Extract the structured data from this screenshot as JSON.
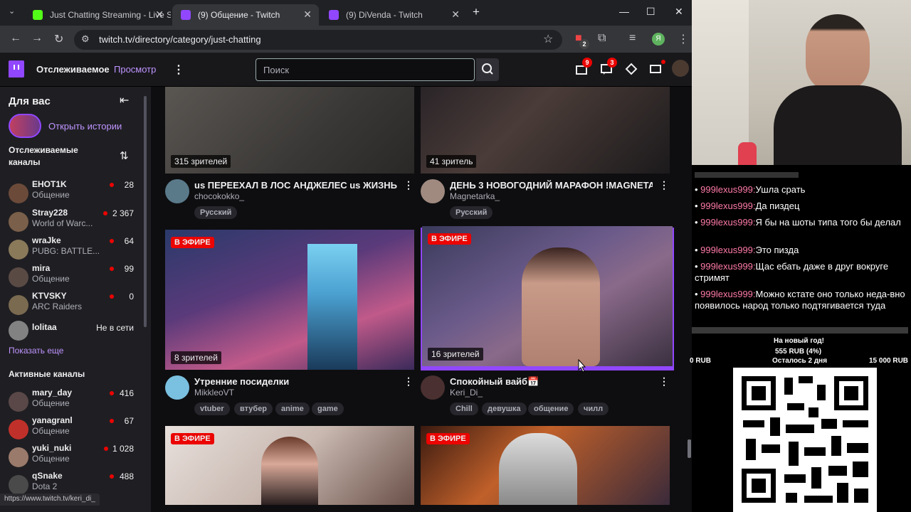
{
  "browser": {
    "tabs": [
      {
        "title": "Just Chatting Streaming - Live S"
      },
      {
        "title": "(9) Общение - Twitch"
      },
      {
        "title": "(9) DiVenda - Twitch"
      }
    ],
    "url": "twitch.tv/directory/category/just-chatting",
    "profile_letter": "Я",
    "ext_badge": "2",
    "status_url": "https://www.twitch.tv/keri_di_"
  },
  "twitch_nav": {
    "following": "Отслеживаемое",
    "browse": "Просмотр",
    "search_placeholder": "Поиск",
    "inbox_count": "9",
    "whispers_count": "3"
  },
  "sidebar": {
    "for_you": "Для вас",
    "open_stories": "Открыть истории",
    "followed_header": "Отслеживаемые каналы",
    "followed": [
      {
        "name": "EHOT1K",
        "game": "Общение",
        "viewers": "28",
        "color": "#6b4a3a"
      },
      {
        "name": "Stray228",
        "game": "World of Warc...",
        "viewers": "2 367",
        "color": "#7a5f4a"
      },
      {
        "name": "wraJke",
        "game": "PUBG: BATTLE...",
        "viewers": "64",
        "color": "#8a7a5a"
      },
      {
        "name": "mira",
        "game": "Общение",
        "viewers": "99",
        "color": "#5a4a44"
      },
      {
        "name": "KTVSKY",
        "game": "ARC Raiders",
        "viewers": "0",
        "color": "#7a6a50"
      },
      {
        "name": "lolitaa",
        "game": "",
        "viewers": "Не в сети",
        "color": "#8a8078"
      }
    ],
    "show_more": "Показать еще",
    "active_header": "Активные каналы",
    "active": [
      {
        "name": "mary_day",
        "game": "Общение",
        "viewers": "416",
        "color": "#5a4848"
      },
      {
        "name": "yanagranl",
        "game": "Общение",
        "viewers": "67",
        "color": "#c0302a"
      },
      {
        "name": "yuki_nuki",
        "game": "Общение",
        "viewers": "1 028",
        "color": "#9a7a6a"
      },
      {
        "name": "qSnake",
        "game": "Dota 2",
        "viewers": "488",
        "color": "#4a4a4a"
      }
    ]
  },
  "streams": [
    {
      "viewers": "315 зрителей",
      "title": "us ПЕРЕЕХАЛ В ЛОС АНДЖЕЛЕС us ЖИЗНЬ К...",
      "channel": "chocokokko_",
      "tags": [
        "Русский"
      ],
      "live": false
    },
    {
      "viewers": "41 зритель",
      "title": "ДЕНЬ 3 НОВОГОДНИЙ МАРАФОН !MAGNETA...",
      "channel": "Magnetarka_",
      "tags": [
        "Русский"
      ],
      "live": false
    },
    {
      "viewers": "8 зрителей",
      "title": "Утренние посиделки",
      "channel": "MikkleoVT",
      "tags": [
        "vtuber",
        "втубер",
        "anime",
        "game"
      ],
      "live": true,
      "live_label": "В ЭФИРЕ"
    },
    {
      "viewers": "16 зрителей",
      "title": "Спокойный вайб📅",
      "channel": "Keri_Di_",
      "tags": [
        "Chill",
        "девушка",
        "общение",
        "чилл"
      ],
      "live": true,
      "live_label": "В ЭФИРЕ"
    },
    {
      "live": true,
      "live_label": "В ЭФИРЕ"
    },
    {
      "live": true,
      "live_label": "В ЭФИРЕ"
    }
  ],
  "chat": [
    {
      "user": "999lexus999:",
      "text": "Ушла срать"
    },
    {
      "user": "999lexus999:",
      "text": "Да пиздец"
    },
    {
      "user": "999lexus999:",
      "text": "Я бы на шоты типа того бы делал"
    },
    {
      "user": "999lexus999:",
      "text": "Это пизда"
    },
    {
      "user": "999lexus999:",
      "text": "Щас ебать даже в друг вокруге стримят"
    },
    {
      "user": "999lexus999:",
      "text": "Можно кстате оно только неда-вно появилось народ только подтягивается туда"
    }
  ],
  "goal": {
    "title": "На новый год!",
    "amount": "555 RUB (4%)",
    "min": "0 RUB",
    "remaining": "Осталось 2 дня",
    "max": "15 000 RUB"
  }
}
